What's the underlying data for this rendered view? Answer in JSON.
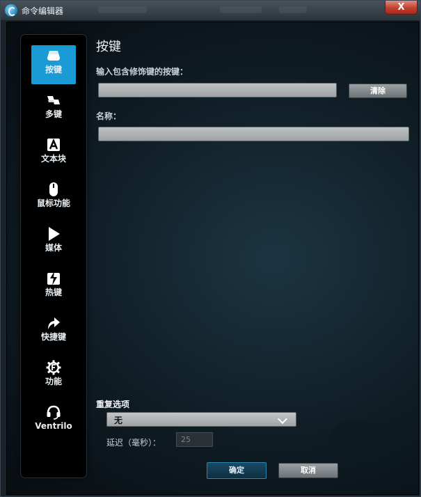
{
  "window": {
    "title": "命令编辑器",
    "close_label": "X"
  },
  "sidebar": {
    "items": [
      {
        "label": "按键",
        "icon": "key-icon",
        "active": true
      },
      {
        "label": "多键",
        "icon": "multikey-icon",
        "active": false
      },
      {
        "label": "文本块",
        "icon": "text-block-icon",
        "active": false
      },
      {
        "label": "鼠标功能",
        "icon": "mouse-icon",
        "active": false
      },
      {
        "label": "媒体",
        "icon": "play-icon",
        "active": false
      },
      {
        "label": "热键",
        "icon": "hotkey-icon",
        "active": false
      },
      {
        "label": "快捷键",
        "icon": "shortcut-arrow-icon",
        "active": false
      },
      {
        "label": "功能",
        "icon": "function-gear-icon",
        "active": false
      },
      {
        "label": "Ventrilo",
        "icon": "headset-icon",
        "active": false
      }
    ]
  },
  "main": {
    "heading": "按键",
    "keystroke_label": "输入包含修饰键的按键：",
    "keystroke_value": "",
    "clear_label": "清除",
    "name_label": "名称：",
    "name_value": "",
    "repeat_label": "重复选项",
    "repeat_selected": "无",
    "delay_label": "延迟（毫秒）：",
    "delay_value": "25",
    "ok_label": "确定",
    "cancel_label": "取消"
  },
  "colors": {
    "accent": "#1a9bd6",
    "close_red": "#c0402f",
    "panel_black": "#000000"
  }
}
